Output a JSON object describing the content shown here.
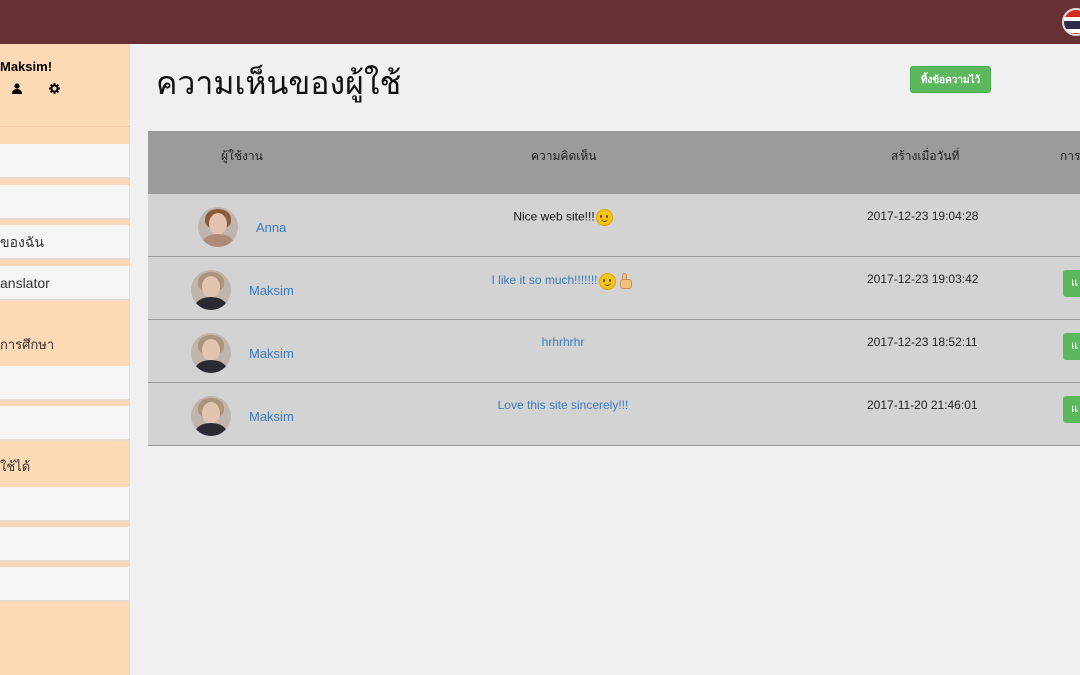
{
  "sidebar": {
    "greeting": "Maksim!",
    "icons": [
      "user-icon",
      "gear-icon"
    ],
    "items": [
      {
        "label": ""
      },
      {
        "label": ""
      },
      {
        "label": "ของฉัน"
      },
      {
        "label": "anslator"
      }
    ],
    "section_education": "การศึกษา",
    "items2": [
      {
        "label": ""
      },
      {
        "label": ""
      }
    ],
    "section_usable": "ใช้ได้",
    "items3": [
      {
        "label": ""
      },
      {
        "label": ""
      },
      {
        "label": ""
      }
    ]
  },
  "main": {
    "title": "ความเห็นของผู้ใช้",
    "add_button_label": "ทิ้งข้อความไว้"
  },
  "table": {
    "headers": {
      "user": "ผู้ใช้งาน",
      "comment": "ความคิดเห็น",
      "created": "สร้างเมื่อวันที่",
      "action": "การ"
    },
    "rows": [
      {
        "user": "Anna",
        "comment": "Nice web site!!!",
        "emoji": [
          "smile-emoji"
        ],
        "date": "2017-12-23 19:04:28",
        "action": ""
      },
      {
        "user": "Maksim",
        "comment": "I like it so much!!!!!!!",
        "emoji": [
          "smile-emoji",
          "thumbs-up-emoji"
        ],
        "date": "2017-12-23 19:03:42",
        "action": "แ"
      },
      {
        "user": "Maksim",
        "comment": "hrhrhrhr",
        "emoji": [],
        "date": "2017-12-23 18:52:11",
        "action": "แ"
      },
      {
        "user": "Maksim",
        "comment": "Love this site sincerely!!!",
        "emoji": [],
        "date": "2017-11-20 21:46:01",
        "action": "แ"
      }
    ]
  },
  "colors": {
    "topbar": "#673032",
    "sidebar": "#fed9b5",
    "accent_green": "#5cb85c",
    "link": "#3b7bbf"
  }
}
